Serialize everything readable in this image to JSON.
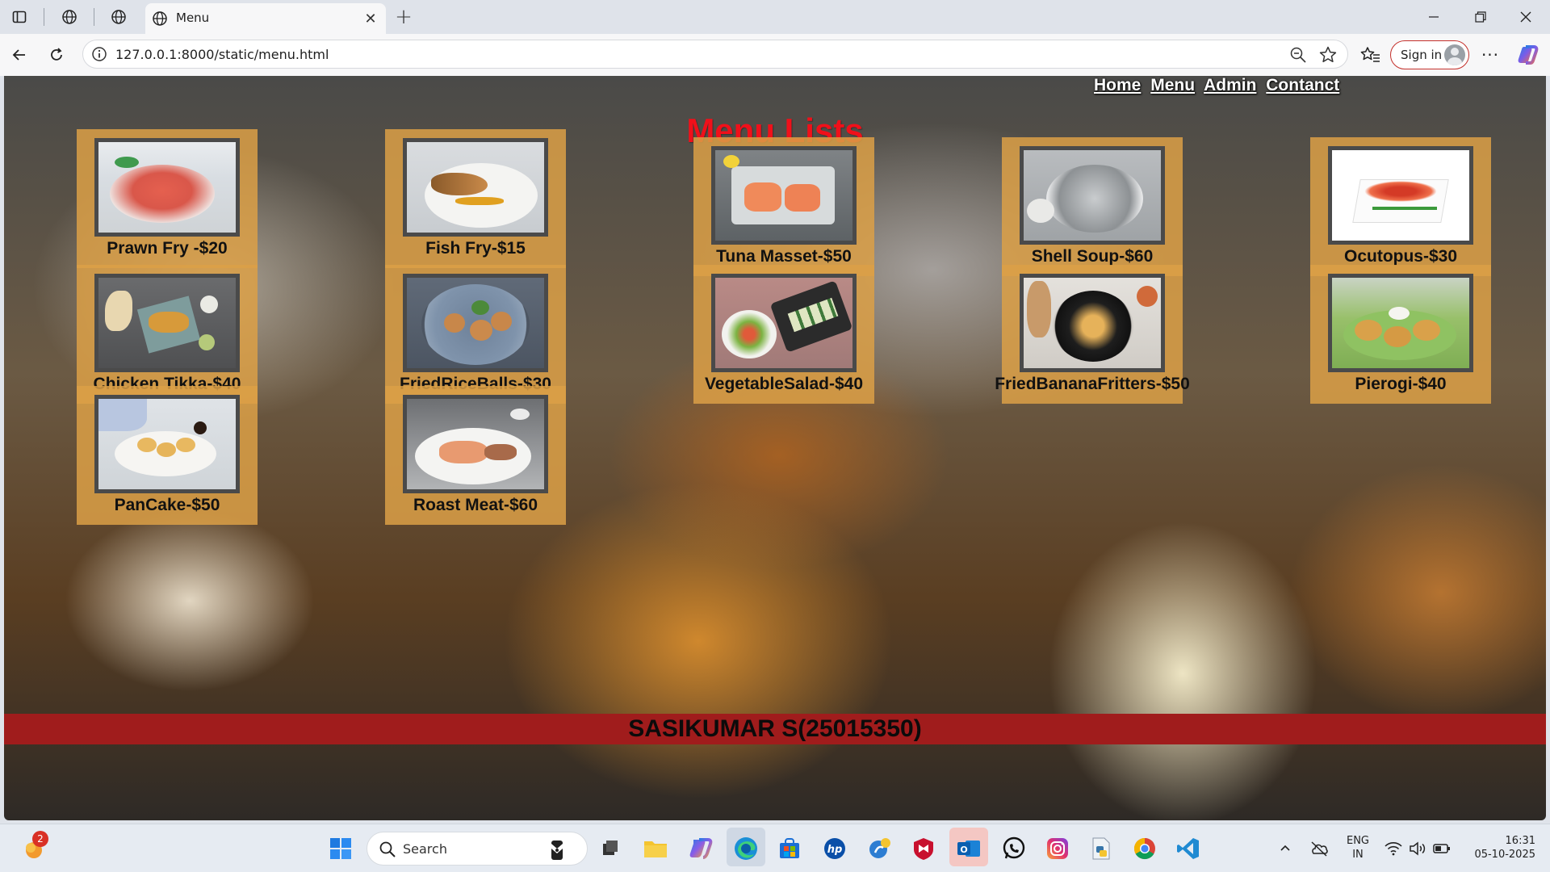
{
  "browser": {
    "tab_title": "Menu",
    "url": "127.0.0.1:8000/static/menu.html",
    "signin_label": "Sign in"
  },
  "page": {
    "nav": [
      "Home",
      "Menu",
      "Admin",
      "Contanct"
    ],
    "heading": "Menu Lists",
    "items": [
      {
        "label": "Prawn Fry -$20"
      },
      {
        "label": "Fish Fry-$15"
      },
      {
        "label": "Tuna Masset-$50"
      },
      {
        "label": "Shell Soup-$60"
      },
      {
        "label": "Ocutopus-$30"
      },
      {
        "label": "Chicken Tikka-$40"
      },
      {
        "label": "FriedRiceBalls-$30"
      },
      {
        "label": "VegetableSalad-$40"
      },
      {
        "label": "FriedBananaFritters-$50"
      },
      {
        "label": "Pierogi-$40"
      },
      {
        "label": "PanCake-$50"
      },
      {
        "label": "Roast Meat-$60"
      }
    ],
    "footer": "SASIKUMAR S(25015350)"
  },
  "taskbar": {
    "search_label": "Search",
    "notification_count": "2",
    "lang": "ENG",
    "region": "IN",
    "time": "16:31",
    "date": "05-10-2025"
  },
  "colors": {
    "heading": "#f0101a",
    "card": "#dca046",
    "footer_bar": "#a01c1c",
    "signin_border": "#c4302b"
  }
}
